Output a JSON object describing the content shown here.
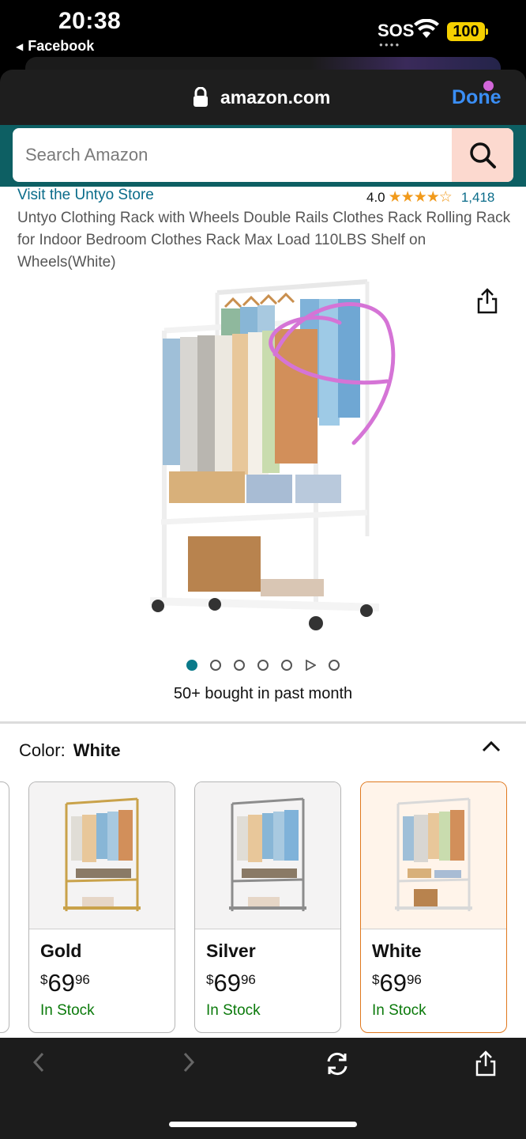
{
  "status_bar": {
    "time": "20:38",
    "back_app": "Facebook",
    "carrier": "SOS",
    "battery": "100"
  },
  "browser": {
    "domain": "amazon.com",
    "done_label": "Done"
  },
  "search": {
    "placeholder": "Search Amazon"
  },
  "product": {
    "store_link": "Visit the Untyo Store",
    "rating_value": "4.0",
    "rating_stars": 4,
    "rating_count": "1,418",
    "title": "Untyo Clothing Rack with Wheels Double Rails Clothes Rack Rolling Rack for Indoor Bedroom Clothes Rack Max Load 110LBS Shelf on Wheels(White)",
    "image_count": 7,
    "active_image": 0,
    "bought_text": "50+ bought in past month"
  },
  "color_section": {
    "label": "Color:",
    "selected": "White",
    "options": [
      {
        "name": "Gold",
        "currency": "$",
        "whole": "69",
        "cents": "96",
        "stock": "In Stock",
        "frame_color": "#c9a24a"
      },
      {
        "name": "Silver",
        "currency": "$",
        "whole": "69",
        "cents": "96",
        "stock": "In Stock",
        "frame_color": "#8c8c8c"
      },
      {
        "name": "White",
        "currency": "$",
        "whole": "69",
        "cents": "96",
        "stock": "In Stock",
        "frame_color": "#e6e6e6"
      }
    ]
  },
  "colors": {
    "amazon_teal": "#0d5f63",
    "link": "#0a6c8a",
    "star": "#f19a1b",
    "in_stock": "#0b7a0b",
    "selected_border": "#e0781e",
    "done_blue": "#3a8ef5",
    "annotation_pink": "#d574d6"
  }
}
